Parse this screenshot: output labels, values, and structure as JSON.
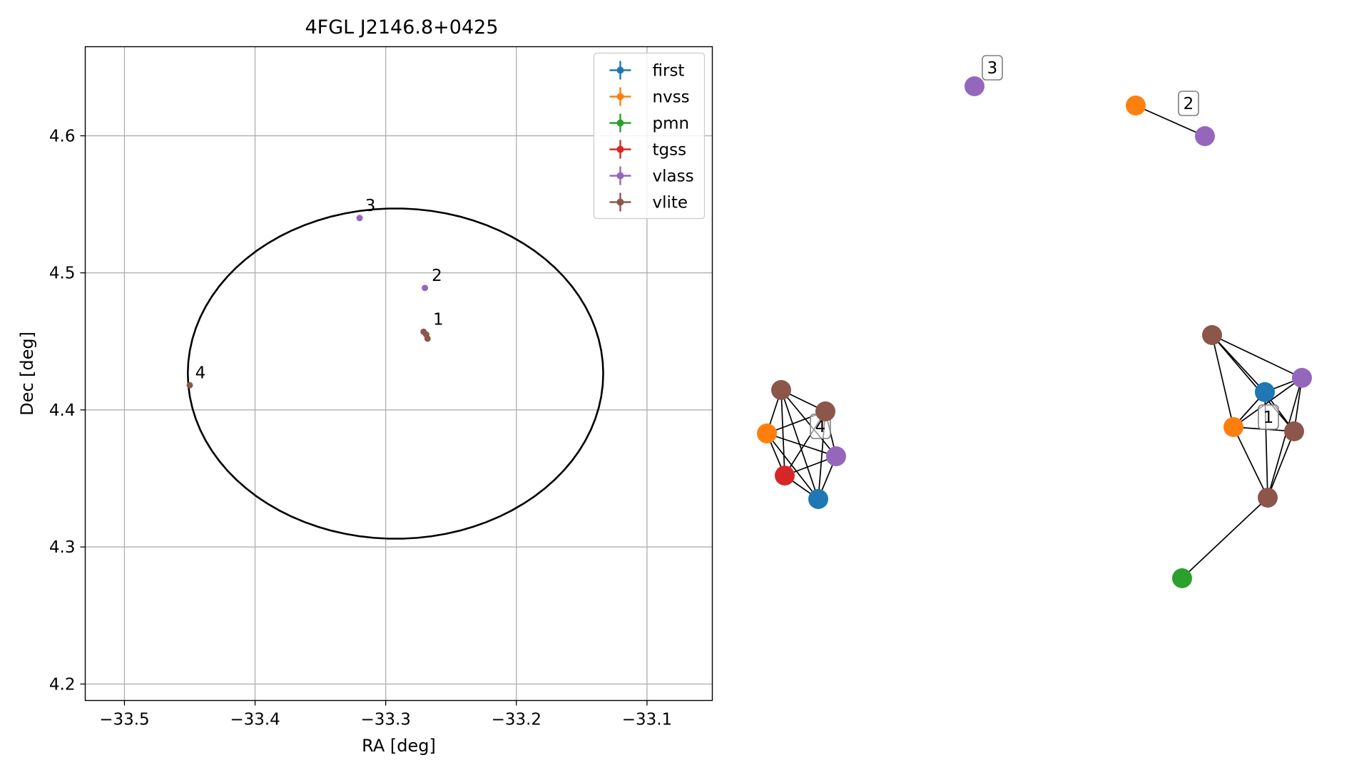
{
  "chart_data": [
    {
      "type": "scatter",
      "title": "4FGL J2146.8+0425",
      "xlabel": "RA [deg]",
      "ylabel": "Dec [deg]",
      "xlim": [
        -33.53,
        -33.05
      ],
      "ylim": [
        4.188,
        4.665
      ],
      "xticks": [
        -33.5,
        -33.4,
        -33.3,
        -33.2,
        -33.1
      ],
      "xtick_labels": [
        "−33.5",
        "−33.4",
        "−33.3",
        "−33.2",
        "−33.1"
      ],
      "yticks": [
        4.2,
        4.3,
        4.4,
        4.5,
        4.6
      ],
      "ytick_labels": [
        "4.2",
        "4.3",
        "4.4",
        "4.5",
        "4.6"
      ],
      "grid": true,
      "legend_placement": "top-right",
      "legend": [
        {
          "name": "first",
          "color": "#1f77b4"
        },
        {
          "name": "nvss",
          "color": "#ff7f0e"
        },
        {
          "name": "pmn",
          "color": "#2ca02c"
        },
        {
          "name": "tgss",
          "color": "#d62728"
        },
        {
          "name": "vlass",
          "color": "#9467bd"
        },
        {
          "name": "vlite",
          "color": "#8c564b"
        }
      ],
      "points": [
        {
          "catalog": "vlass",
          "ra": -33.32,
          "dec": 4.54
        },
        {
          "catalog": "vlass",
          "ra": -33.27,
          "dec": 4.489
        },
        {
          "catalog": "vlite",
          "ra": -33.271,
          "dec": 4.457
        },
        {
          "catalog": "vlite",
          "ra": -33.269,
          "dec": 4.455
        },
        {
          "catalog": "vlite",
          "ra": -33.268,
          "dec": 4.452
        },
        {
          "catalog": "vlite",
          "ra": -33.45,
          "dec": 4.418
        }
      ],
      "point_labels": [
        {
          "text": "3",
          "ra": -33.318,
          "dec": 4.541
        },
        {
          "text": "2",
          "ra": -33.267,
          "dec": 4.49
        },
        {
          "text": "1",
          "ra": -33.266,
          "dec": 4.458
        },
        {
          "text": "4",
          "ra": -33.448,
          "dec": 4.419
        }
      ],
      "ellipse": {
        "center_ra": -33.2925,
        "center_dec": 4.4265,
        "semi_ra": 0.159,
        "semi_dec": 0.1205,
        "color": "#000000"
      }
    },
    {
      "type": "network",
      "clusters": [
        {
          "label": "4",
          "nodes": [
            {
              "catalog": "vlite",
              "color": "#8c564b"
            },
            {
              "catalog": "vlite",
              "color": "#8c564b"
            },
            {
              "catalog": "nvss",
              "color": "#ff7f0e"
            },
            {
              "catalog": "vlass",
              "color": "#9467bd"
            },
            {
              "catalog": "tgss",
              "color": "#d62728"
            },
            {
              "catalog": "first",
              "color": "#1f77b4"
            }
          ]
        },
        {
          "label": "3",
          "nodes": [
            {
              "catalog": "vlass",
              "color": "#9467bd"
            }
          ]
        },
        {
          "label": "2",
          "nodes": [
            {
              "catalog": "nvss",
              "color": "#ff7f0e"
            },
            {
              "catalog": "vlass",
              "color": "#9467bd"
            }
          ]
        },
        {
          "label": "1",
          "nodes": [
            {
              "catalog": "vlite",
              "color": "#8c564b"
            },
            {
              "catalog": "vlass",
              "color": "#9467bd"
            },
            {
              "catalog": "first",
              "color": "#1f77b4"
            },
            {
              "catalog": "nvss",
              "color": "#ff7f0e"
            },
            {
              "catalog": "vlite",
              "color": "#8c564b"
            },
            {
              "catalog": "vlite",
              "color": "#8c564b"
            },
            {
              "catalog": "pmn",
              "color": "#2ca02c"
            }
          ]
        }
      ]
    }
  ]
}
